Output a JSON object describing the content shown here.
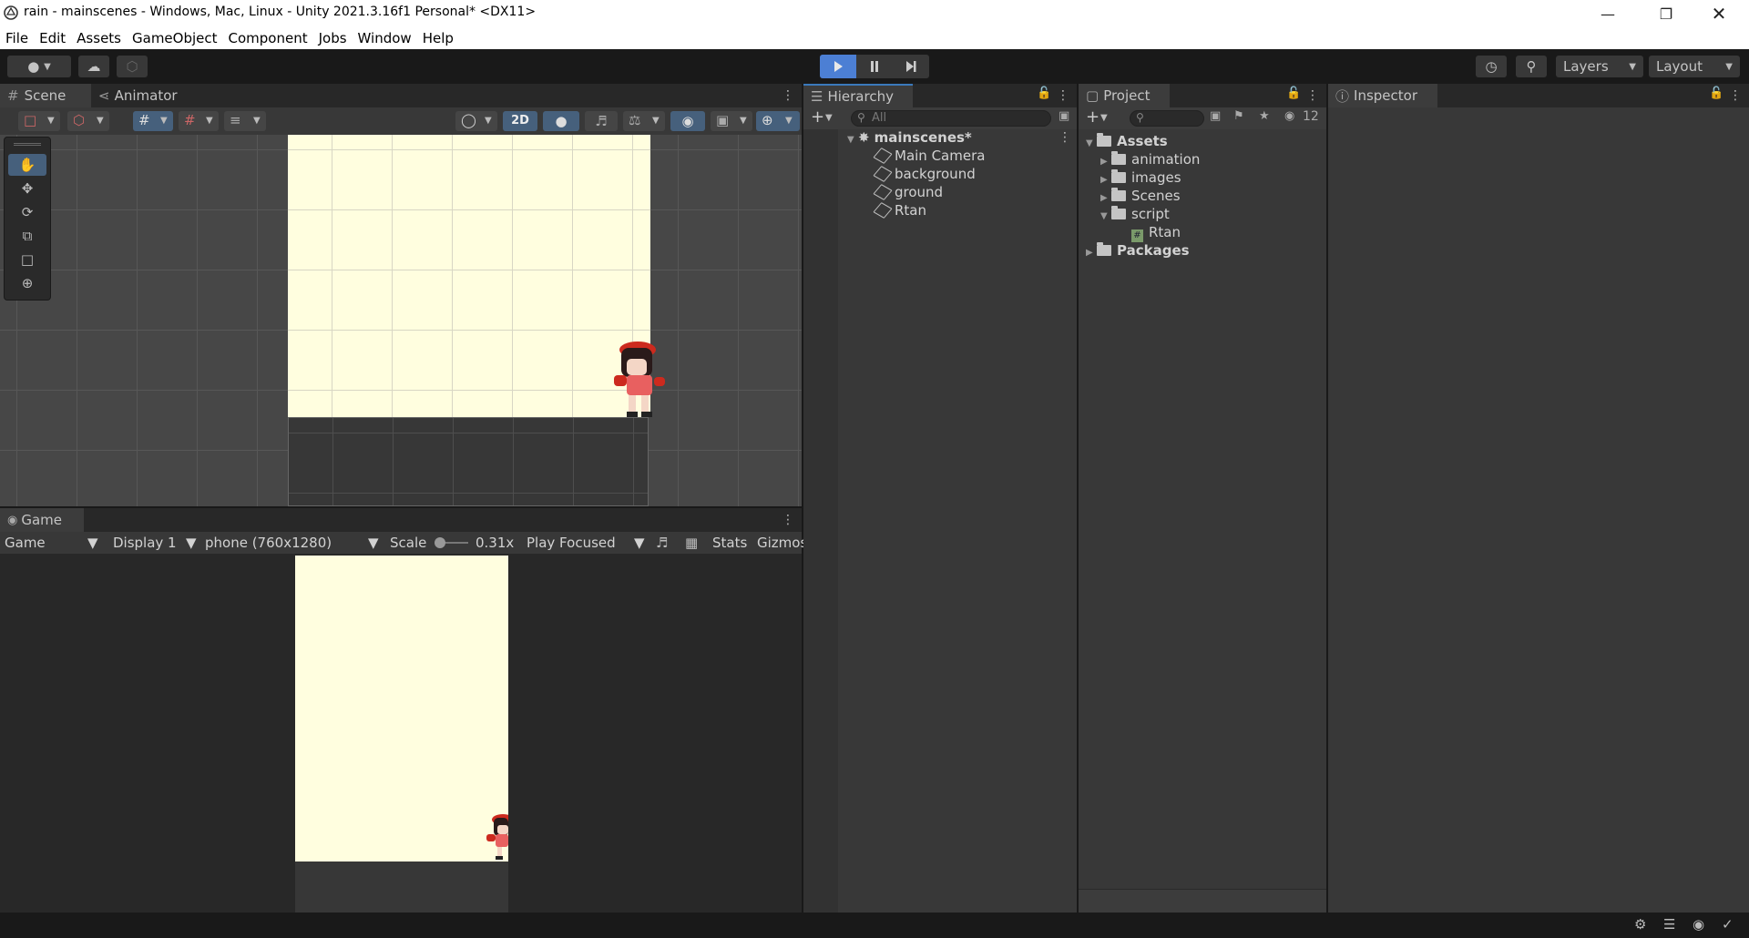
{
  "window": {
    "title": "rain - mainscenes - Windows, Mac, Linux - Unity 2021.3.16f1 Personal* <DX11>",
    "minimize_icon": "minimize-icon",
    "maximize_icon": "restore-icon",
    "close_icon": "close-icon"
  },
  "menu": [
    "File",
    "Edit",
    "Assets",
    "GameObject",
    "Component",
    "Jobs",
    "Window",
    "Help"
  ],
  "toolbar": {
    "layers_label": "Layers",
    "layout_label": "Layout"
  },
  "scene_panel": {
    "tabs": [
      "Scene",
      "Animator"
    ],
    "mode_2d_label": "2D"
  },
  "game_panel": {
    "tab_label": "Game",
    "view_select": "Game",
    "display_select": "Display 1",
    "resolution_select": "phone (760x1280)",
    "scale_label": "Scale",
    "scale_value": "0.31x",
    "play_mode": "Play Focused",
    "stats_label": "Stats",
    "gizmos_label": "Gizmos"
  },
  "hierarchy": {
    "tab_label": "Hierarchy",
    "search_placeholder": "All",
    "scene_name": "mainscenes*",
    "objects": [
      "Main Camera",
      "background",
      "ground",
      "Rtan"
    ]
  },
  "project": {
    "tab_label": "Project",
    "hidden_count": "12",
    "root_assets": "Assets",
    "folders": [
      "animation",
      "images",
      "Scenes",
      "script"
    ],
    "script_file": "Rtan",
    "root_packages": "Packages"
  },
  "inspector": {
    "tab_label": "Inspector"
  },
  "colors": {
    "editor_bg": "#383838",
    "tab_bar": "#282828",
    "camera_bg": "#fffedf",
    "play_accent": "#4c7fd4"
  }
}
